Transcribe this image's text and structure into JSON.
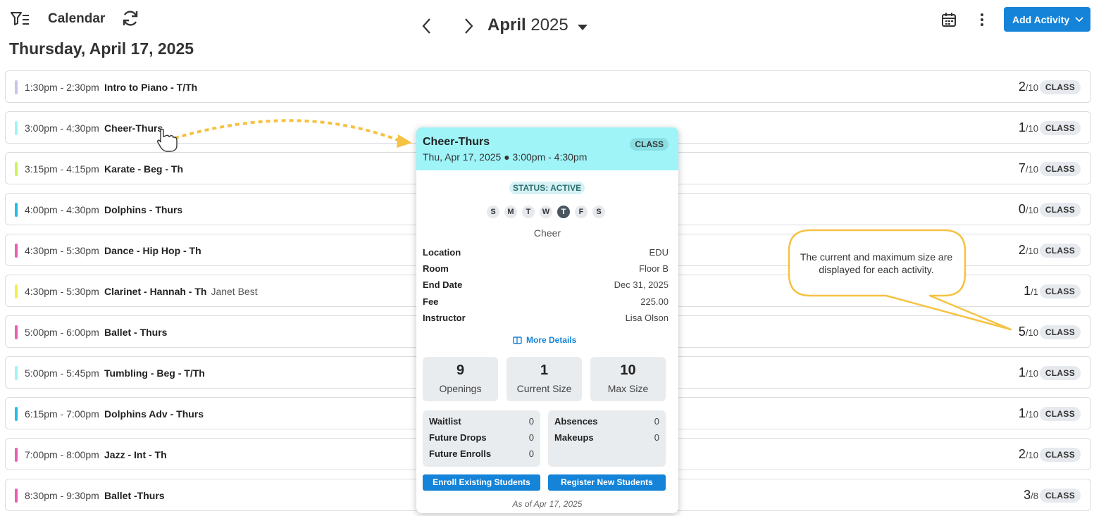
{
  "header": {
    "app_title": "Calendar",
    "date_title": "Thursday, April 17, 2025",
    "month_name": "April",
    "year": "2025",
    "add_activity_label": "Add Activity",
    "icons": [
      "filter-icon",
      "refresh-icon",
      "chevron-left-icon",
      "chevron-right-icon",
      "caret-down-icon",
      "calendar-icon",
      "more-vert-icon",
      "chevron-down-icon"
    ]
  },
  "rows": [
    {
      "time": "1:30pm - 2:30pm",
      "name": "Intro to Piano - T/Th",
      "sub": "",
      "current": "2",
      "max": "/10",
      "badge": "CLASS",
      "color": "#c9c3ee"
    },
    {
      "time": "3:00pm - 4:30pm",
      "name": "Cheer-Thurs",
      "sub": "",
      "current": "1",
      "max": "/10",
      "badge": "CLASS",
      "color": "#9ff4f8"
    },
    {
      "time": "3:15pm - 4:15pm",
      "name": "Karate - Beg - Th",
      "sub": "",
      "current": "7",
      "max": "/10",
      "badge": "CLASS",
      "color": "#cdf25a"
    },
    {
      "time": "4:00pm - 4:30pm",
      "name": "Dolphins - Thurs",
      "sub": "",
      "current": "0",
      "max": "/10",
      "badge": "CLASS",
      "color": "#23bde8"
    },
    {
      "time": "4:30pm - 5:30pm",
      "name": "Dance - Hip Hop - Th",
      "sub": "",
      "current": "2",
      "max": "/10",
      "badge": "CLASS",
      "color": "#ef5bb9"
    },
    {
      "time": "4:30pm - 5:30pm",
      "name": "Clarinet - Hannah - Th",
      "sub": "Janet Best",
      "current": "1",
      "max": "/1",
      "badge": "CLASS",
      "color": "#f4f045"
    },
    {
      "time": "5:00pm - 6:00pm",
      "name": "Ballet - Thurs",
      "sub": "",
      "current": "5",
      "max": "/10",
      "badge": "CLASS",
      "color": "#ef5bb9"
    },
    {
      "time": "5:00pm - 5:45pm",
      "name": "Tumbling - Beg - T/Th",
      "sub": "",
      "current": "1",
      "max": "/10",
      "badge": "CLASS",
      "color": "#9ff4f8"
    },
    {
      "time": "6:15pm - 7:00pm",
      "name": "Dolphins Adv - Thurs",
      "sub": "",
      "current": "1",
      "max": "/10",
      "badge": "CLASS",
      "color": "#23bde8"
    },
    {
      "time": "7:00pm - 8:00pm",
      "name": "Jazz - Int - Th",
      "sub": "",
      "current": "2",
      "max": "/10",
      "badge": "CLASS",
      "color": "#ef5bb9"
    },
    {
      "time": "8:30pm - 9:30pm",
      "name": "Ballet -Thurs",
      "sub": "",
      "current": "3",
      "max": "/8",
      "badge": "CLASS",
      "color": "#ef5bb9"
    }
  ],
  "popup": {
    "title": "Cheer-Thurs",
    "when": "Thu, Apr 17, 2025 ● 3:00pm - 4:30pm",
    "badge": "CLASS",
    "status": "STATUS: ACTIVE",
    "days": [
      "S",
      "M",
      "T",
      "W",
      "T",
      "F",
      "S"
    ],
    "active_day": "T",
    "category": "Cheer",
    "details": [
      {
        "label": "Location",
        "value": "EDU"
      },
      {
        "label": "Room",
        "value": "Floor B"
      },
      {
        "label": "End Date",
        "value": "Dec 31, 2025"
      },
      {
        "label": "Fee",
        "value": "225.00"
      },
      {
        "label": "Instructor",
        "value": "Lisa Olson"
      }
    ],
    "more_details": "More Details",
    "stats": {
      "openings": {
        "value": "9",
        "label": "Openings"
      },
      "current": {
        "value": "1",
        "label": "Current Size"
      },
      "max": {
        "value": "10",
        "label": "Max Size"
      }
    },
    "waitlist": {
      "label": "Waitlist",
      "value": "0"
    },
    "future_drops": {
      "label": "Future Drops",
      "value": "0"
    },
    "future_enrolls": {
      "label": "Future Enrolls",
      "value": "0"
    },
    "absences": {
      "label": "Absences",
      "value": "0"
    },
    "makeups": {
      "label": "Makeups",
      "value": "0"
    },
    "enroll_label": "Enroll Existing Students",
    "register_label": "Register New Students",
    "as_of": "As of Apr 17, 2025"
  },
  "annotation": {
    "callout_text": "The current and maximum size are displayed for each activity.",
    "color": "#f5c242"
  },
  "colors": {
    "accent": "#1583d8",
    "popup_header": "#9ff4f8"
  }
}
